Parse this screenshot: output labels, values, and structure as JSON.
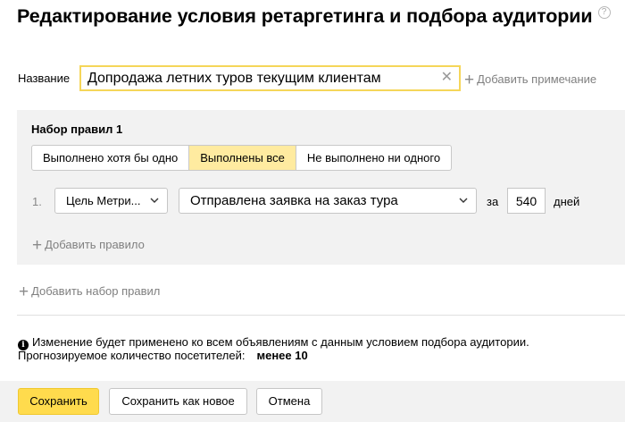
{
  "page": {
    "title": "Редактирование условия ретаргетинга и подбора аудитории",
    "help_symbol": "?"
  },
  "name_field": {
    "label": "Название",
    "value": "Допродажа летних туров текущим клиентам",
    "clear_symbol": "✕"
  },
  "add_note": {
    "plus": "+",
    "label": "Добавить примечание"
  },
  "ruleset": {
    "title": "Набор правил 1",
    "segments": [
      {
        "label": "Выполнено хотя бы одно",
        "active": false
      },
      {
        "label": "Выполнены все",
        "active": true
      },
      {
        "label": "Не выполнено ни одного",
        "active": false
      }
    ],
    "rule": {
      "number": "1.",
      "goal_type": "Цель Метри...",
      "event": "Отправлена заявка на заказ тура",
      "for_label": "за",
      "days_value": "540",
      "days_label": "дней"
    },
    "add_rule": {
      "plus": "+",
      "label": "Добавить правило"
    }
  },
  "add_ruleset": {
    "plus": "+",
    "label": "Добавить набор правил"
  },
  "info": {
    "icon": "i",
    "text": "Изменение будет применено ко всем объявлениям с данным условием подбора аудитории.",
    "forecast_label": "Прогнозируемое количество посетителей:",
    "forecast_value": "менее 10"
  },
  "footer": {
    "save": "Сохранить",
    "save_new": "Сохранить как новое",
    "cancel": "Отмена"
  },
  "colors": {
    "accent_yellow": "#ffdb4d",
    "active_segment": "#ffeba0",
    "input_focus_border": "#f5d659",
    "panel_background": "#f2f2f2",
    "muted_text": "#808080"
  },
  "icons": {
    "help": "question-circle-icon",
    "clear": "clear-x-icon",
    "plus": "plus-icon",
    "chevron": "chevron-down-icon",
    "info": "info-circle-icon"
  }
}
